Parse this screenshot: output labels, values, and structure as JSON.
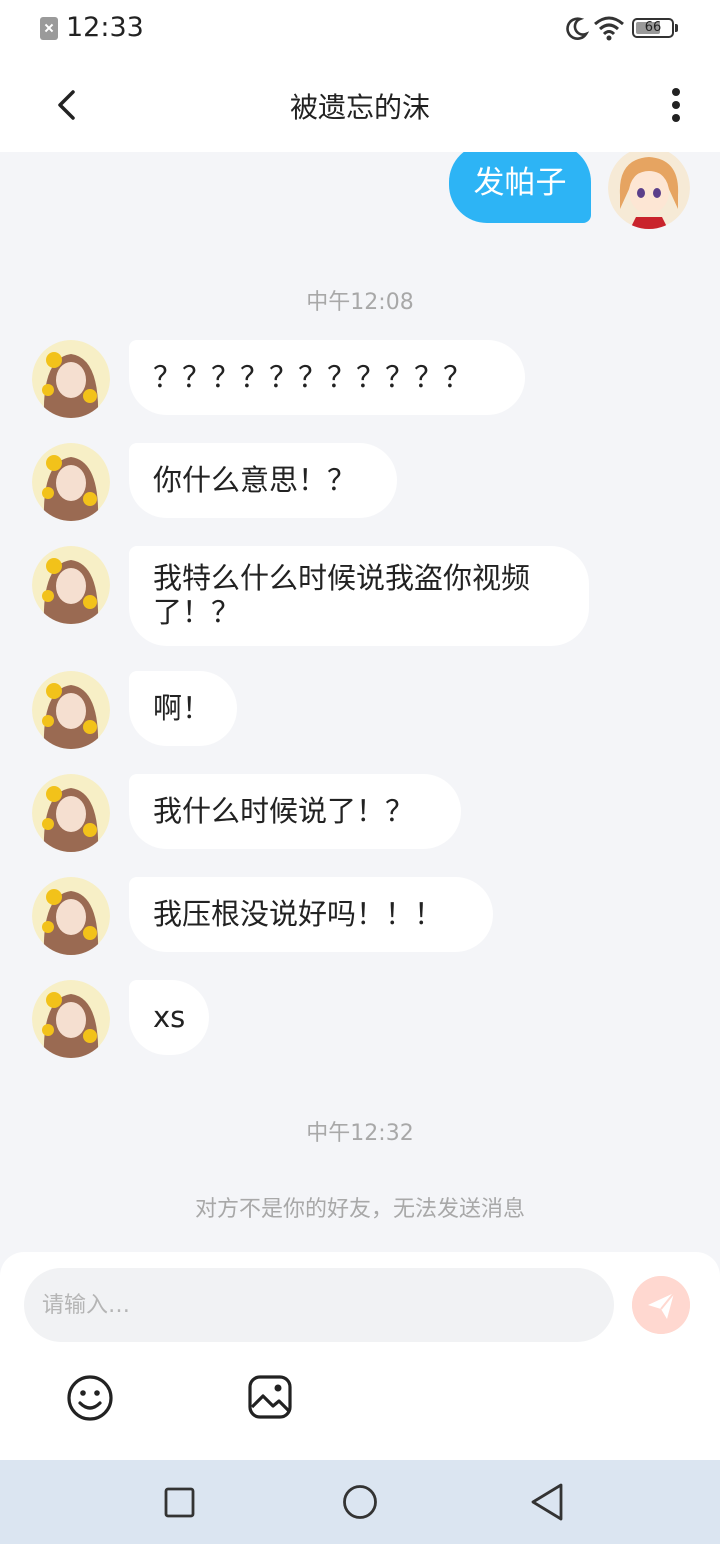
{
  "status_bar": {
    "time": "12:33",
    "battery_level": "66",
    "icons": [
      "notification-blocked-icon",
      "moon-icon",
      "wifi-icon",
      "battery-icon"
    ]
  },
  "header": {
    "title": "被遗忘的沫",
    "back_icon": "chevron-left-icon",
    "more_icon": "more-vertical-icon"
  },
  "chat": {
    "self_message": "发帕子",
    "timestamp_1": "中午12:08",
    "messages": [
      {
        "text": "？？？？？？？？？？？"
      },
      {
        "text": "你什么意思！？"
      },
      {
        "text": "我特么什么时候说我盗你视频了！？"
      },
      {
        "text": "啊！"
      },
      {
        "text": "我什么时候说了！？"
      },
      {
        "text": "我压根没说好吗！！！"
      },
      {
        "text": "xs"
      }
    ],
    "timestamp_2": "中午12:32",
    "notice": "对方不是你的好友，无法发送消息"
  },
  "composer": {
    "placeholder": "请输入…",
    "send_icon": "send-icon",
    "emoji_icon": "emoji-icon",
    "image_icon": "image-icon"
  },
  "nav": {
    "icons": [
      "recent-apps-icon",
      "home-icon",
      "back-icon"
    ]
  },
  "colors": {
    "self_bubble": "#2db4f5",
    "background": "#f4f5f8",
    "send_button": "#ffd8d0",
    "nav_bar": "#dbe5f1"
  }
}
